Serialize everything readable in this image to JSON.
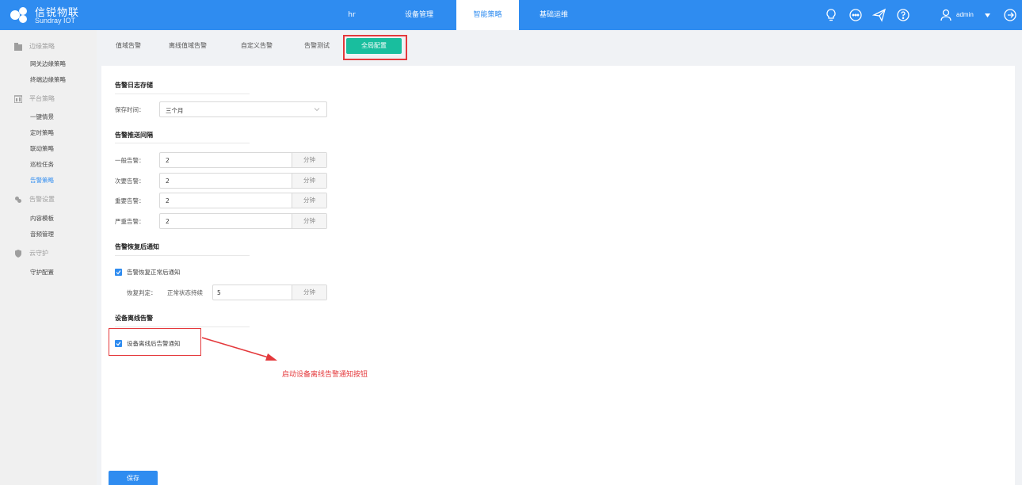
{
  "brand": {
    "title": "信锐物联",
    "subtitle": "Sundray IOT",
    "color": "#2f8cf0"
  },
  "topnav": {
    "items": [
      {
        "label": "hr",
        "active": false
      },
      {
        "label": "设备管理",
        "active": false
      },
      {
        "label": "智能策略",
        "active": true
      },
      {
        "label": "基础运维",
        "active": false
      }
    ],
    "icons": [
      "bulb-icon",
      "chat-icon",
      "send-icon",
      "help-icon",
      "user-icon",
      "logout-icon"
    ],
    "user": "admin"
  },
  "sidebar": {
    "groups": [
      {
        "label": "边缘策略",
        "icon": "edge-icon",
        "items": [
          "网关边缘策略",
          "终端边缘策略"
        ]
      },
      {
        "label": "平台策略",
        "icon": "platform-icon",
        "items": [
          "一键情景",
          "定时策略",
          "联动策略",
          "巡检任务",
          "告警策略"
        ]
      },
      {
        "label": "告警设置",
        "icon": "alarm-settings-icon",
        "items": [
          "内容模板",
          "音频管理"
        ]
      },
      {
        "label": "云守护",
        "icon": "shield-icon",
        "items": [
          "守护配置"
        ]
      }
    ],
    "active_item": "告警策略"
  },
  "tabs": [
    "值域告警",
    "离线值域告警",
    "自定义告警",
    "告警测试",
    "全局配置"
  ],
  "active_tab": "全局配置",
  "log_storage": {
    "title": "告警日志存储",
    "retention_label": "保存时间：",
    "retention_value": "三个月"
  },
  "push_interval": {
    "title": "告警推送间隔",
    "rows": [
      {
        "label": "一般告警：",
        "value": "2",
        "unit": "分钟"
      },
      {
        "label": "次要告警：",
        "value": "2",
        "unit": "分钟"
      },
      {
        "label": "重要告警：",
        "value": "2",
        "unit": "分钟"
      },
      {
        "label": "严重告警：",
        "value": "2",
        "unit": "分钟"
      }
    ]
  },
  "recovery": {
    "title": "告警恢复后通知",
    "checkbox_label": "告警恢复正常后通知",
    "checked": true,
    "judge_label": "恢复判定：",
    "judge_text": "正常状态持续",
    "judge_value": "5",
    "judge_unit": "分钟"
  },
  "offline": {
    "title": "设备离线告警",
    "checkbox_label": "设备离线后告警通知",
    "checked": true
  },
  "annotation": {
    "text": "启动设备离线告警通知按钮",
    "color": "#e4393c"
  },
  "save_label": "保存"
}
